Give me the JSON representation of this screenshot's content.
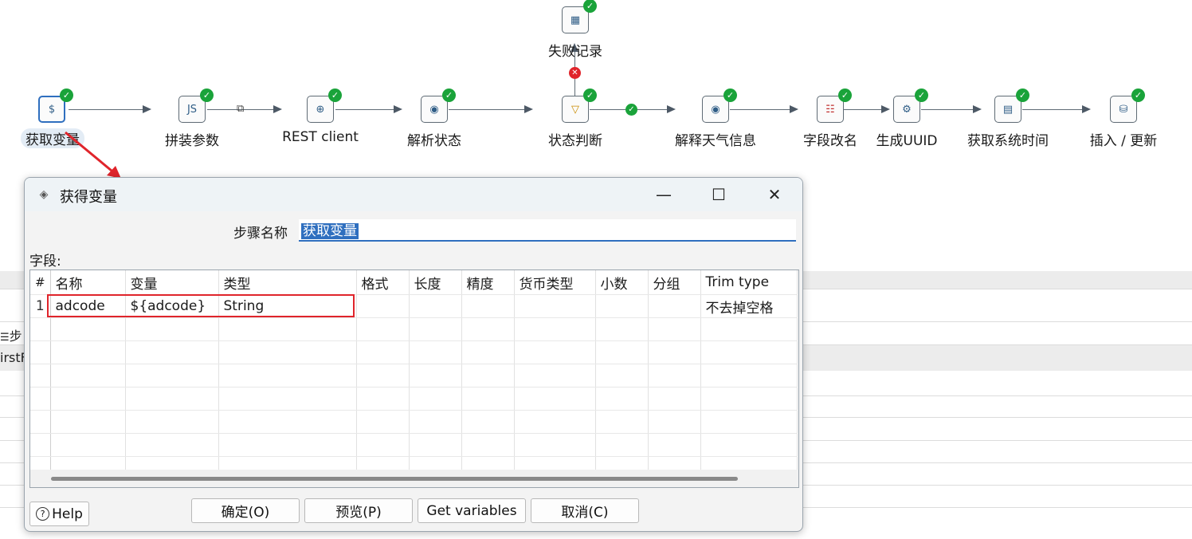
{
  "canvas": {
    "background_labels": [
      "步",
      "irstF"
    ],
    "steps": [
      {
        "label": "获取变量",
        "icon": "variable-icon",
        "selected": true
      },
      {
        "label": "拼装参数",
        "icon": "script-icon"
      },
      {
        "label": "REST client",
        "icon": "rest-client-icon"
      },
      {
        "label": "解析状态",
        "icon": "json-input-icon"
      },
      {
        "label": "状态判断",
        "icon": "filter-rows-icon"
      },
      {
        "label": "解释天气信息",
        "icon": "json-input-icon"
      },
      {
        "label": "字段改名",
        "icon": "select-values-icon"
      },
      {
        "label": "生成UUID",
        "icon": "uuid-icon"
      },
      {
        "label": "获取系统时间",
        "icon": "system-info-icon"
      },
      {
        "label": "插入 / 更新",
        "icon": "insert-update-icon"
      },
      {
        "label": "失败记录",
        "icon": "text-output-icon"
      }
    ],
    "status_color": "#1aa33a",
    "error_color": "#e0242b"
  },
  "dialog": {
    "title": "获得变量",
    "minimize_glyph": "—",
    "maximize_glyph": "☐",
    "close_glyph": "✕",
    "step_name_label": "步骤名称",
    "step_name_value": "获取变量",
    "fields_label": "字段:",
    "table": {
      "row_number_header": "#",
      "columns": [
        "名称",
        "变量",
        "类型",
        "格式",
        "长度",
        "精度",
        "货币类型",
        "小数",
        "分组",
        "Trim type"
      ],
      "rows": [
        {
          "num": "1",
          "cells": [
            "adcode",
            "${adcode}",
            "String",
            "",
            "",
            "",
            "",
            "",
            "",
            "不去掉空格"
          ]
        }
      ]
    },
    "buttons": {
      "help": "Help",
      "ok": "确定(O)",
      "preview": "预览(P)",
      "get_variables": "Get variables",
      "cancel": "取消(C)"
    }
  }
}
